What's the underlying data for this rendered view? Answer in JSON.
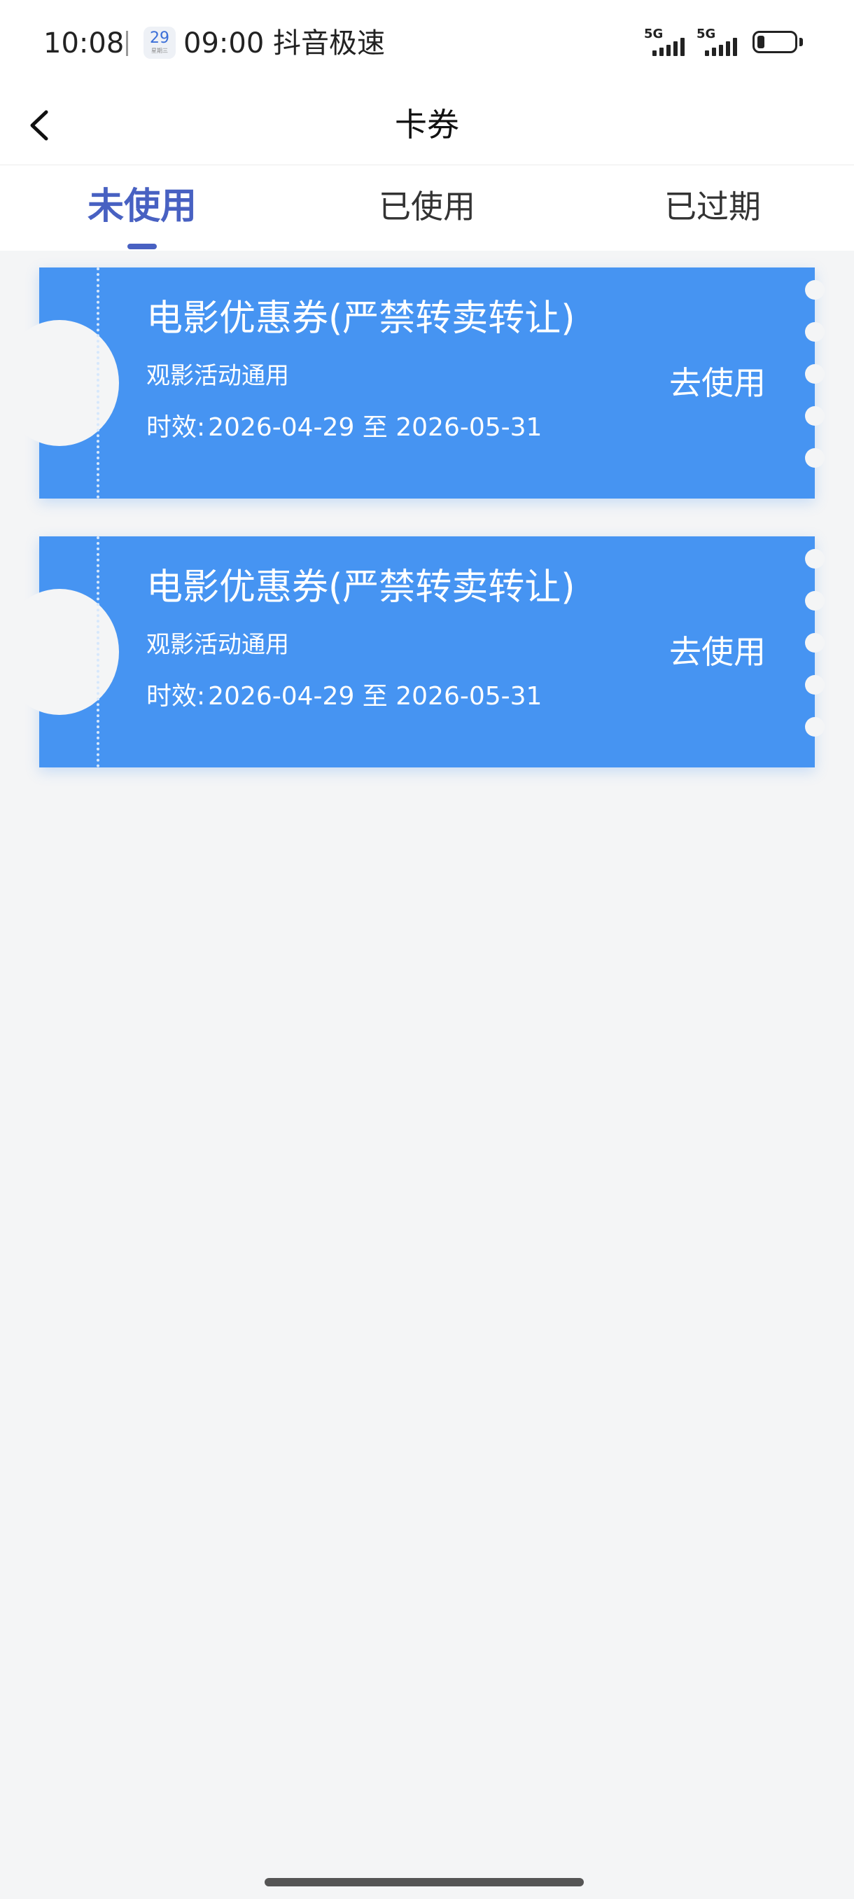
{
  "status_bar": {
    "time": "10:08",
    "calendar_day": "29",
    "calendar_sub": "星期三",
    "notification": "09:00 抖音极速",
    "network_1": "5G",
    "network_2": "5G",
    "battery_level": 0.2
  },
  "nav": {
    "title": "卡券",
    "back_icon": "chevron-left-icon"
  },
  "tabs": [
    {
      "label": "未使用",
      "active": true
    },
    {
      "label": "已使用",
      "active": false
    },
    {
      "label": "已过期",
      "active": false
    }
  ],
  "coupons": [
    {
      "title": "电影优惠券(严禁转卖转让)",
      "description": "观影活动通用",
      "validity_label": "时效:",
      "validity_range": "2026-04-29 至 2026-05-31",
      "action": "去使用"
    },
    {
      "title": "电影优惠券(严禁转卖转让)",
      "description": "观影活动通用",
      "validity_label": "时效:",
      "validity_range": "2026-04-29 至 2026-05-31",
      "action": "去使用"
    }
  ],
  "colors": {
    "accent": "#4861c2",
    "coupon_bg": "#4694f2",
    "page_bg": "#f4f5f6"
  }
}
